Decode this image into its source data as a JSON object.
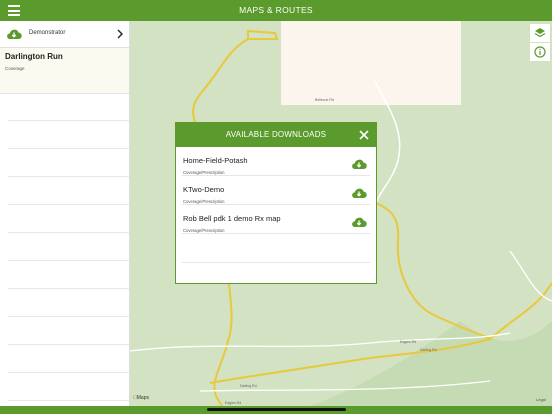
{
  "header": {
    "title": "MAPS & ROUTES"
  },
  "sidebar": {
    "account_label": "Demonstrator",
    "selected_field": {
      "name": "Darlington Run",
      "type": "Coverage"
    }
  },
  "dialog": {
    "title": "AVAILABLE DOWNLOADS",
    "items": [
      {
        "name": "Home-Field-Potash",
        "type": "Coverage/Prescription"
      },
      {
        "name": "KTwo-Demo",
        "type": "Coverage/Prescription"
      },
      {
        "name": "Rob Bell pdk 1 demo Rx map",
        "type": "Coverage/Prescription"
      }
    ]
  },
  "map": {
    "attribution": "Maps",
    "legal": "Legal",
    "road_labels": [
      "Bellevue Rd",
      "Eagles Rd",
      "Darling Rd",
      "Darling Rd",
      "Eagles Rd"
    ]
  },
  "icons": {
    "menu": "hamburger-icon",
    "cloud": "cloud-download-icon",
    "chevron": "chevron-right-icon",
    "close": "close-icon",
    "layers": "layers-icon",
    "info": "info-icon"
  },
  "colors": {
    "brand": "#5b9a2c",
    "route": "#e8c83c",
    "map_bg": "#d3e2c2"
  }
}
